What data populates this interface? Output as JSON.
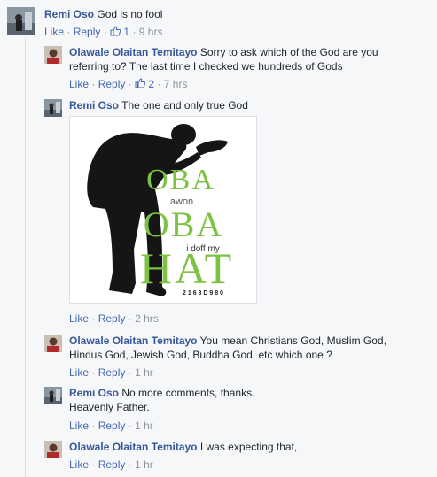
{
  "comments": [
    {
      "author": "Remi Oso",
      "text": "God is no fool",
      "like": "Like",
      "reply": "Reply",
      "likes_count": "1",
      "time": "9 hrs"
    },
    {
      "author": "Olawale Olaitan Temitayo",
      "text_line1": "Sorry to ask which of the God are you",
      "text_line2": "referring to? The last time I checked we hundreds of Gods",
      "like": "Like",
      "reply": "Reply",
      "likes_count": "2",
      "time": "7 hrs"
    },
    {
      "author": "Remi Oso",
      "text": "The one and only true God",
      "like": "Like",
      "reply": "Reply",
      "time": "2 hrs",
      "image": {
        "line1": "OBA",
        "line2": "awon",
        "line3": "OBA",
        "line4": "i doff my",
        "line5": "HAT",
        "code": "2 1 6 3 D 9 8 0"
      }
    },
    {
      "author": "Olawale Olaitan Temitayo",
      "text_line1": "You mean Christians God, Muslim God,",
      "text_line2": "Hindus God, Jewish God, Buddha God, etc which one ?",
      "like": "Like",
      "reply": "Reply",
      "time": "1 hr"
    },
    {
      "author": "Remi Oso",
      "text_line1": "No more comments, thanks.",
      "text_line2": "Heavenly Father.",
      "like": "Like",
      "reply": "Reply",
      "time": "1 hr"
    },
    {
      "author": "Olawale Olaitan Temitayo",
      "text": "I was expecting that,",
      "like": "Like",
      "reply": "Reply",
      "time": "1 hr"
    }
  ],
  "colors": {
    "link": "#4267b2",
    "author": "#365899",
    "meta": "#90949c",
    "green": "#7dc242"
  },
  "icons": [
    "thumbs-up-icon"
  ]
}
